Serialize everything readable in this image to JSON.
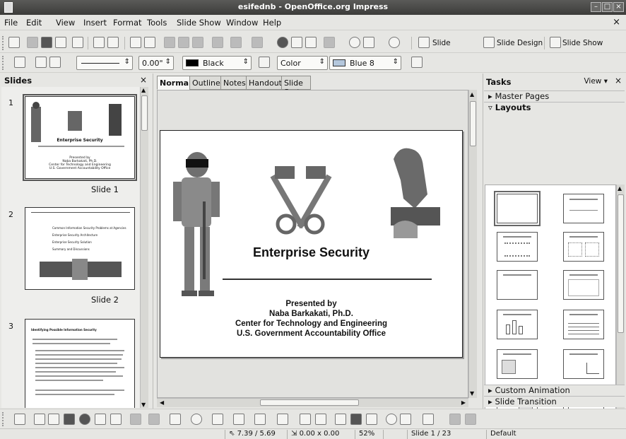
{
  "window": {
    "title": "esifednb - OpenOffice.org Impress"
  },
  "menu": [
    "File",
    "Edit",
    "View",
    "Insert",
    "Format",
    "Tools",
    "Slide Show",
    "Window",
    "Help"
  ],
  "toolbar": {
    "slide_label": "Slide",
    "slide_design_label": "Slide Design",
    "slide_show_label": "Slide Show"
  },
  "linebar": {
    "width_value": "0.00\"",
    "line_color": "Black",
    "area_style": "Color",
    "area_color": "Blue 8",
    "black_hex": "#000000",
    "blue8_hex": "#b4c7dc"
  },
  "slides_pane": {
    "title": "Slides",
    "items": [
      {
        "number": "1",
        "label": "Slide 1",
        "title": "Enterprise Security",
        "lines": [
          "Presented by",
          "Naba Barkakati, Ph.D.",
          "Center for Technology and Engineering",
          "U.S. Government Accountability Office"
        ]
      },
      {
        "number": "2",
        "label": "Slide 2",
        "bullets": [
          "Common Information Security Problems at Agencies",
          "Enterprise Security Architecture",
          "Enterprise Security Solution",
          "Summary and Discussions"
        ]
      },
      {
        "number": "3",
        "title": "Identifying Possible Information Security"
      }
    ]
  },
  "view_tabs": [
    "Normal",
    "Outline",
    "Notes",
    "Handout",
    "Slide Sorter"
  ],
  "slide": {
    "title": "Enterprise Security",
    "presented_by": "Presented by",
    "presenter": "Naba Barkakati, Ph.D.",
    "org1": "Center for Technology and Engineering",
    "org2": "U.S. Government Accountability Office"
  },
  "tasks": {
    "title": "Tasks",
    "view_label": "View",
    "sections": {
      "master_pages": "Master Pages",
      "layouts": "Layouts",
      "custom_animation": "Custom Animation",
      "slide_transition": "Slide Transition"
    }
  },
  "status": {
    "position": "7.39 / 5.69",
    "size": "0.00 x 0.00",
    "zoom": "52%",
    "page": "Slide 1 / 23",
    "layout": "Default"
  }
}
